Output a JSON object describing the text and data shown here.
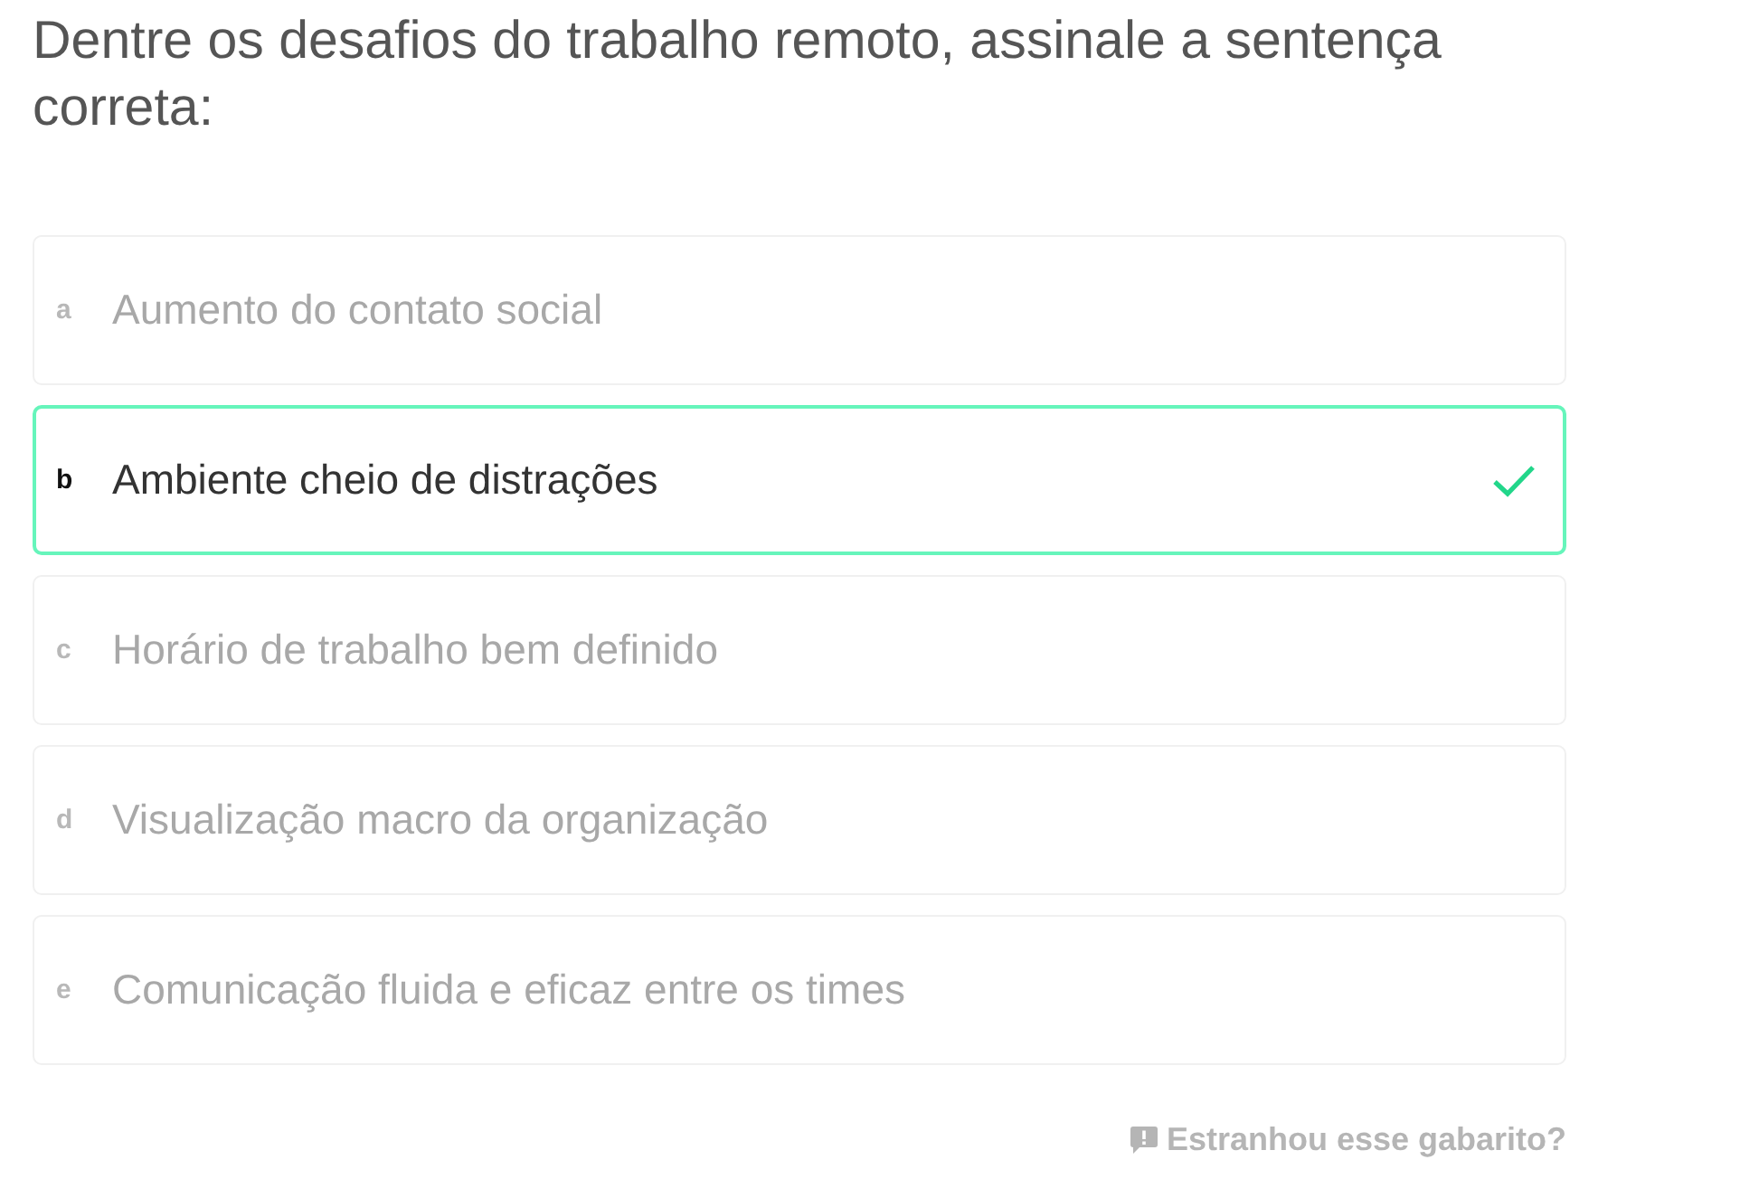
{
  "question": "Dentre os desafios do trabalho remoto, assinale a sentença correta:",
  "options": [
    {
      "letter": "a",
      "text": "Aumento do contato social",
      "selected": false,
      "correct": false
    },
    {
      "letter": "b",
      "text": "Ambiente cheio de distrações",
      "selected": true,
      "correct": true
    },
    {
      "letter": "c",
      "text": "Horário de trabalho bem definido",
      "selected": false,
      "correct": false
    },
    {
      "letter": "d",
      "text": "Visualização macro da organização",
      "selected": false,
      "correct": false
    },
    {
      "letter": "e",
      "text": "Comunicação fluida e eficaz entre os times",
      "selected": false,
      "correct": false
    }
  ],
  "report_link": "Estranhou esse gabarito?"
}
